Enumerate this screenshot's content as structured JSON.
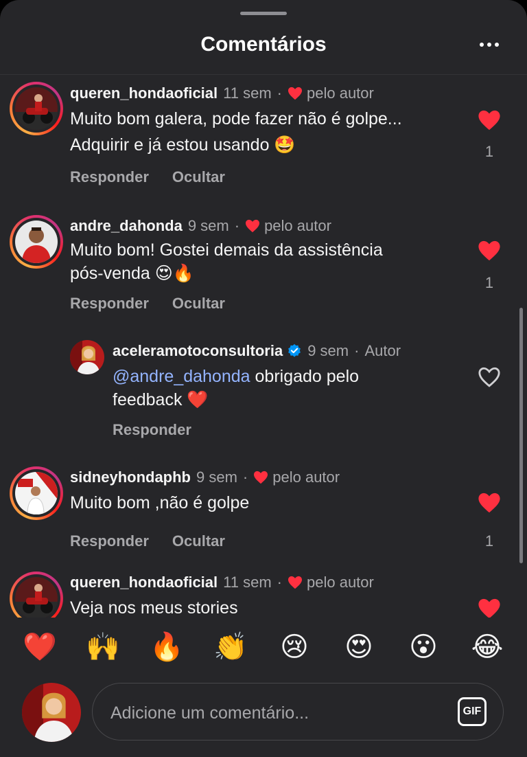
{
  "header": {
    "title": "Comentários"
  },
  "comments": [
    {
      "username": "queren_hondaoficial",
      "time": "11 sem",
      "liked_by": "pelo autor",
      "line1": "Muito bom galera, pode fazer não é golpe...",
      "line2": "Adquirir e já estou usando 🤩",
      "reply_label": "Responder",
      "hide_label": "Ocultar",
      "like_count": "1"
    },
    {
      "username": "andre_dahonda",
      "time": "9 sem",
      "liked_by": "pelo autor",
      "line1": "Muito bom! Gostei demais da assistência",
      "line2": "pós-venda 😍🔥",
      "reply_label": "Responder",
      "hide_label": "Ocultar",
      "like_count": "1",
      "reply": {
        "username": "aceleramotoconsultoria",
        "time": "9 sem",
        "author_tag": "Autor",
        "mention": "@andre_dahonda",
        "line1_rest": " obrigado pelo",
        "line2": "feedback ❤️",
        "reply_label": "Responder"
      }
    },
    {
      "username": "sidneyhondaphb",
      "time": "9 sem",
      "liked_by": "pelo autor",
      "line1": "Muito bom ,não é golpe",
      "reply_label": "Responder",
      "hide_label": "Ocultar",
      "like_count": "1"
    },
    {
      "username": "queren_hondaoficial",
      "time": "11 sem",
      "liked_by": "pelo autor",
      "line1": "Veja nos meus stories"
    }
  ],
  "emoji_bar": [
    "❤️",
    "🙌",
    "🔥",
    "👏",
    "😢",
    "😍",
    "😮",
    "😂"
  ],
  "composer": {
    "placeholder": "Adicione um comentário...",
    "gif_label": "GIF"
  },
  "colors": {
    "background": "#262629",
    "like_red": "#ff3040",
    "mention": "#94b4ff",
    "muted": "#a8a8ab",
    "verified": "#0095f6"
  },
  "icons": {
    "like": "heart-filled-icon",
    "unliked": "heart-outline-icon",
    "verified": "verified-badge-icon",
    "more": "more-horizontal-icon"
  }
}
